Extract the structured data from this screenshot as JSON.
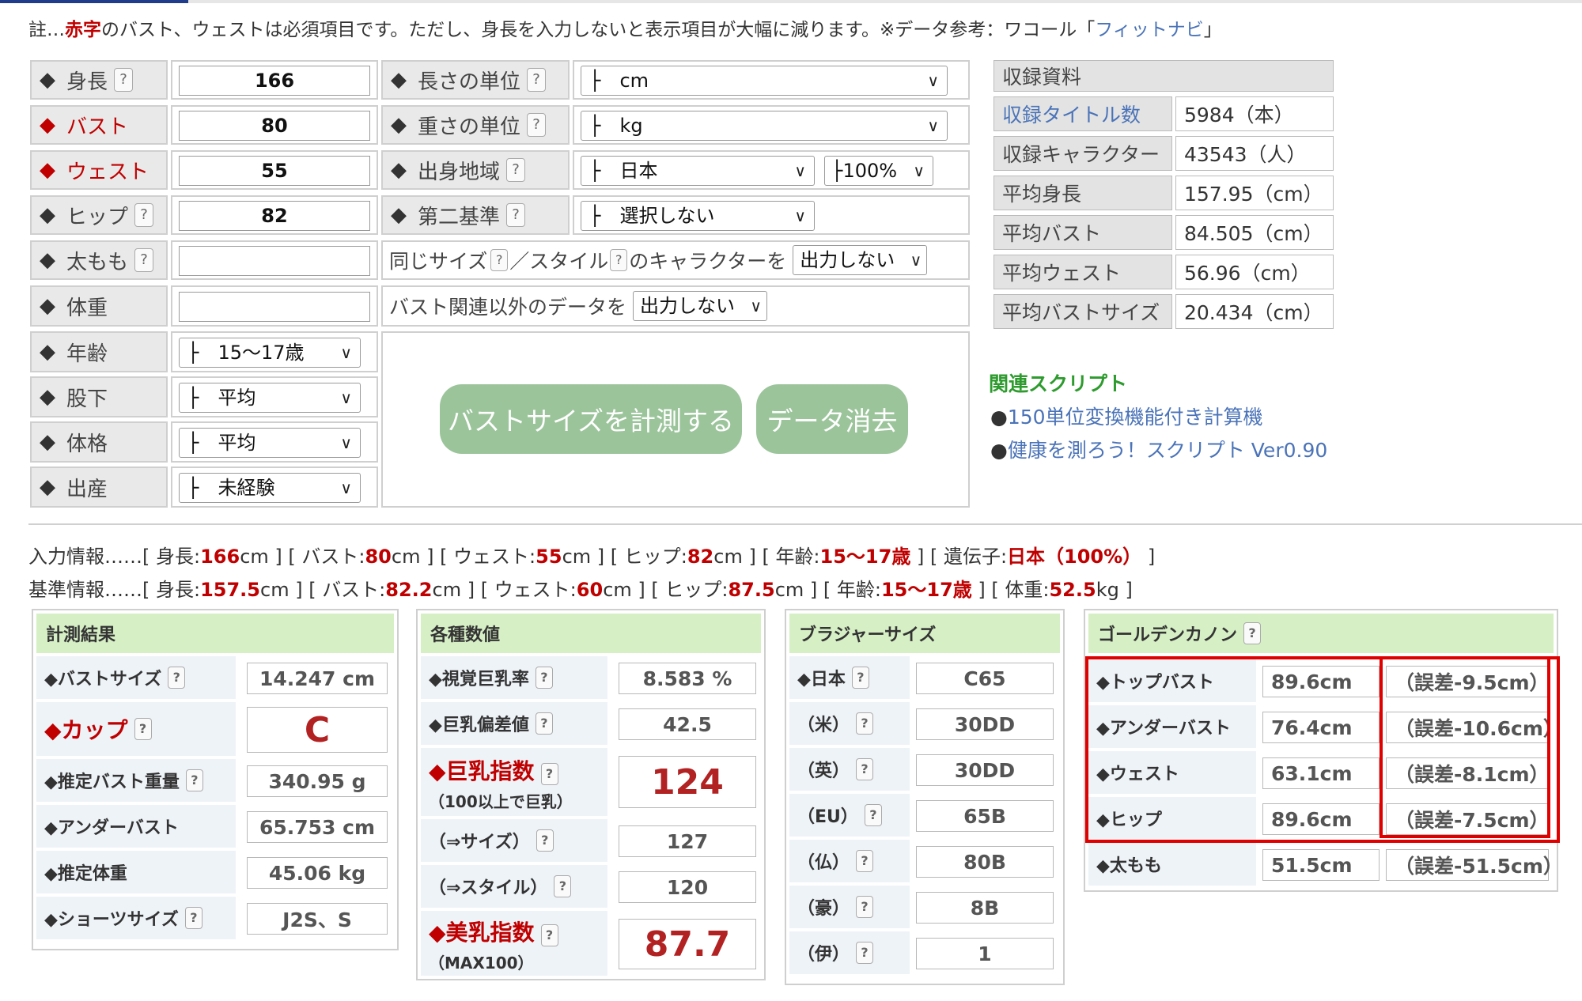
{
  "note": {
    "prefix": "註…",
    "red_word": "赤字",
    "middle": "のバスト、ウェストは必須項目です。ただし、身長を入力しないと表示項目が大幅に減ります。※データ参考：ワコール「",
    "link": "フィットナビ",
    "suffix": "」"
  },
  "form": {
    "height": {
      "label": "身長",
      "value": "166"
    },
    "bust": {
      "label": "バスト",
      "value": "80"
    },
    "waist": {
      "label": "ウェスト",
      "value": "55"
    },
    "hip": {
      "label": "ヒップ",
      "value": "82"
    },
    "thigh": {
      "label": "太もも",
      "value": ""
    },
    "weight": {
      "label": "体重",
      "value": ""
    },
    "age": {
      "label": "年齢",
      "value": "├　15～17歳"
    },
    "inseam": {
      "label": "股下",
      "value": "├　平均"
    },
    "build": {
      "label": "体格",
      "value": "├　平均"
    },
    "birth": {
      "label": "出産",
      "value": "├　未経験"
    },
    "length_unit": {
      "label": "長さの単位",
      "value": "├　cm"
    },
    "weight_unit": {
      "label": "重さの単位",
      "value": "├　kg"
    },
    "origin": {
      "label": "出身地域",
      "value": "├　日本",
      "pct": "├100%"
    },
    "second_std": {
      "label": "第二基準",
      "value": "├　選択しない"
    },
    "same_size": {
      "pre": "同じサイズ",
      "mid": "／スタイル",
      "post": "のキャラクターを",
      "select": "出力しない"
    },
    "non_bust": {
      "text": "バスト関連以外のデータを",
      "select": "出力しない"
    },
    "measure_button": "バストサイズを計測する",
    "clear_button": "データ消去",
    "q_mark": "?"
  },
  "records": {
    "title": "収録資料",
    "rows": [
      {
        "label": "収録タイトル数",
        "value": "5984（本）"
      },
      {
        "label": "収録キャラクター",
        "value": "43543（人）"
      },
      {
        "label": "平均身長",
        "value": "157.95（cm）"
      },
      {
        "label": "平均バスト",
        "value": "84.505（cm）"
      },
      {
        "label": "平均ウェスト",
        "value": "56.96（cm）"
      },
      {
        "label": "平均バストサイズ",
        "value": "20.434（cm）"
      }
    ]
  },
  "related": {
    "title": "関連スクリプト",
    "bullet": "●",
    "links": [
      "150単位変換機能付き計算機",
      "健康を測ろう！スクリプト Ver0.90"
    ]
  },
  "input_info": {
    "lead": "入力情報……[ 身長:",
    "h": "166",
    "t1": "cm ] [ バスト:",
    "b": "80",
    "t2": "cm ] [ ウェスト:",
    "w": "55",
    "t3": "cm ] [ ヒップ:",
    "hip": "82",
    "t4": "cm ] [ 年齢:",
    "age": "15～17歳",
    "t5": " ] [ 遺伝子:",
    "gene": "日本（100%）",
    "t6": " ]"
  },
  "base_info": {
    "lead": "基準情報……[ 身長:",
    "h": "157.5",
    "t1": "cm ] [ バスト:",
    "b": "82.2",
    "t2": "cm ] [ ウェスト:",
    "w": "60",
    "t3": "cm ] [ ヒップ:",
    "hip": "87.5",
    "t4": "cm ] [ 年齢:",
    "age": "15～17歳",
    "t5": " ] [ 体重:",
    "wt": "52.5",
    "t6": "kg ]"
  },
  "results": {
    "title": "計測結果",
    "bust_size": {
      "label": "◆バストサイズ",
      "value": "14.247 cm"
    },
    "cup": {
      "label": "◆カップ",
      "value": "C"
    },
    "bust_weight": {
      "label": "◆推定バスト重量",
      "value": "340.95 g"
    },
    "underbust": {
      "label": "◆アンダーバスト",
      "value": "65.753 cm"
    },
    "est_weight": {
      "label": "◆推定体重",
      "value": "45.06 kg"
    },
    "shorts": {
      "label": "◆ショーツサイズ",
      "value": "J2S、S"
    }
  },
  "metrics": {
    "title": "各種数値",
    "visual": {
      "label": "◆視覚巨乳率",
      "value": "8.583 %"
    },
    "deviation": {
      "label": "◆巨乳偏差値",
      "value": "42.5"
    },
    "index": {
      "label": "◆巨乳指数",
      "sub": "（100以上で巨乳）",
      "value": "124"
    },
    "size": {
      "label": "（⇒サイズ）",
      "value": "127"
    },
    "style": {
      "label": "（⇒スタイル）",
      "value": "120"
    },
    "beauty": {
      "label": "◆美乳指数",
      "sub": "（MAX100）",
      "value": "87.7"
    }
  },
  "bra": {
    "title": "ブラジャーサイズ",
    "rows": [
      {
        "label": "◆日本",
        "value": "C65"
      },
      {
        "label": "（米）",
        "value": "30DD"
      },
      {
        "label": "（英）",
        "value": "30DD"
      },
      {
        "label": "（EU）",
        "value": "65B"
      },
      {
        "label": "（仏）",
        "value": "80B"
      },
      {
        "label": "（豪）",
        "value": "8B"
      },
      {
        "label": "（伊）",
        "value": "1"
      }
    ]
  },
  "golden": {
    "title": "ゴールデンカノン",
    "rows": [
      {
        "label": "◆トップバスト",
        "value": "89.6cm",
        "err": "（誤差-9.5cm）"
      },
      {
        "label": "◆アンダーバスト",
        "value": "76.4cm",
        "err": "（誤差-10.6cm）"
      },
      {
        "label": "◆ウェスト",
        "value": "63.1cm",
        "err": "（誤差-8.1cm）"
      },
      {
        "label": "◆ヒップ",
        "value": "89.6cm",
        "err": "（誤差-7.5cm）"
      },
      {
        "label": "◆太もも",
        "value": "51.5cm",
        "err": "（誤差-51.5cm）"
      }
    ]
  },
  "colors": {
    "accent_red": "#c00000",
    "button_green": "#9bc49b",
    "panel_header": "#d6efc5",
    "highlight_box": "#e00000"
  }
}
